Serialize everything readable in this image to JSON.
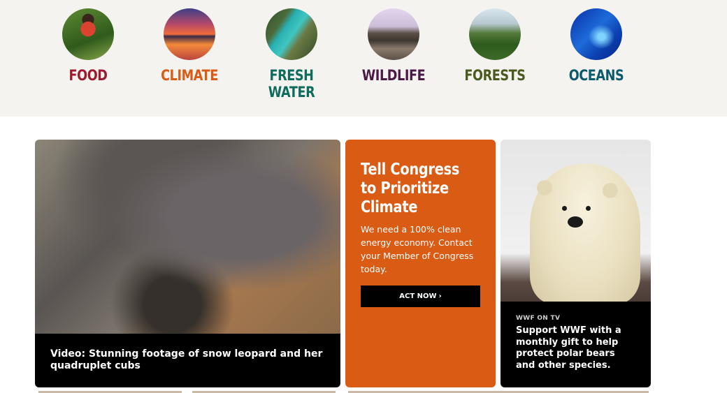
{
  "topics": [
    {
      "label": "FOOD",
      "color": "#9b1b30",
      "icon": "food-photo-woman-harvesting"
    },
    {
      "label": "CLIMATE",
      "color": "#d95b14",
      "icon": "climate-photo-sunset"
    },
    {
      "label": "FRESH WATER",
      "color": "#0f6b5c",
      "icon": "fresh-water-photo-river"
    },
    {
      "label": "WILDLIFE",
      "color": "#4a1a45",
      "icon": "wildlife-photo-elephants"
    },
    {
      "label": "FORESTS",
      "color": "#4a5a1e",
      "icon": "forests-photo-trees"
    },
    {
      "label": "OCEANS",
      "color": "#0b5a6e",
      "icon": "oceans-photo-fish"
    }
  ],
  "video_card": {
    "title": "Video: Stunning footage of snow leopard and her quadruplet cubs",
    "image": "snow-leopard-photo"
  },
  "cta_card": {
    "heading": "Tell Congress to Prioritize Climate",
    "text": "We need a 100% clean energy economy. Contact your Member of Congress today.",
    "button_label": "ACT NOW",
    "button_icon": "chevron-right-icon",
    "background": "#d95b14"
  },
  "bear_card": {
    "eyebrow": "WWF ON TV",
    "title": "Support WWF with a monthly gift to help protect polar bears and other species.",
    "image": "polar-bear-photo"
  }
}
